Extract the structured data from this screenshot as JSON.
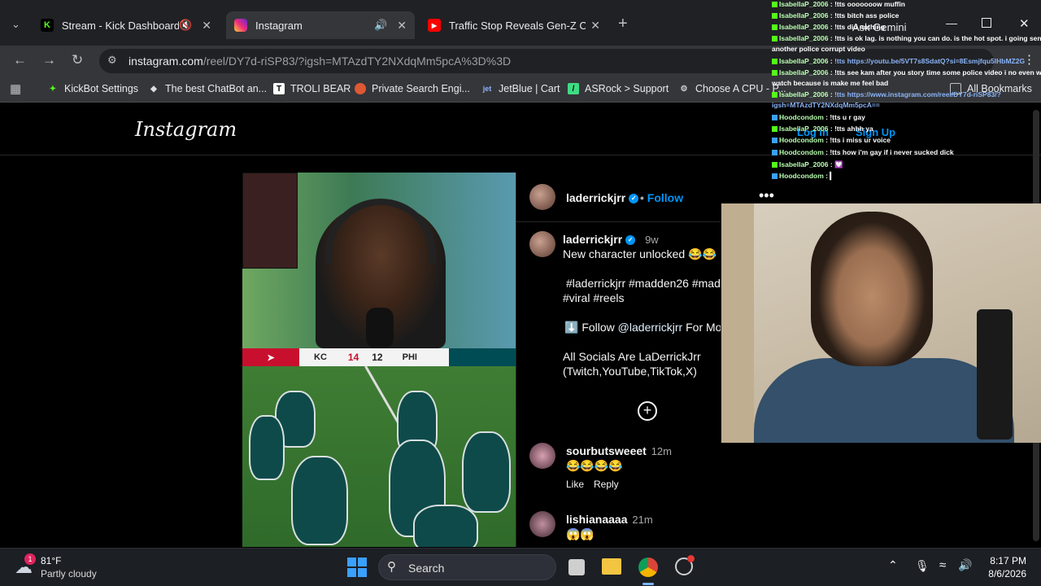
{
  "browser": {
    "tabs": [
      {
        "title": "Stream - Kick Dashboard",
        "favicon": "K",
        "color": "#53fc18"
      },
      {
        "title": "Instagram",
        "favicon": "ig",
        "color": "#e1306c"
      },
      {
        "title": "Traffic Stop Reveals Gen-Z Coup",
        "favicon": "yt",
        "color": "#ff0000"
      }
    ],
    "new_tab": "+",
    "url_host": "instagram.com",
    "url_path": "/reel/DY7d-riSP83/?igsh=MTAzdTY2NXdqMm5pcA%3D%3D",
    "ask_gemini": "Ask Gemini",
    "bookmarks": [
      {
        "label": "KickBot Settings",
        "icon_color": "#53fc18"
      },
      {
        "label": "The best ChatBot an...",
        "icon_color": "#cccccc"
      },
      {
        "label": "TROLI BEAR",
        "icon_color": "#ffffff"
      },
      {
        "label": "Private Search Engi...",
        "icon_color": "#de5833"
      },
      {
        "label": "JetBlue | Cart",
        "icon_color": "#1a3f8f"
      },
      {
        "label": "ASRock > Support",
        "icon_color": "#3ddc84"
      },
      {
        "label": "Choose A CPU - P...",
        "icon_color": "#aaaaaa"
      }
    ],
    "all_bookmarks": "All Bookmarks"
  },
  "instagram": {
    "logo": "Instagram",
    "login": "Log in",
    "signup": "Sign Up",
    "post": {
      "username": "laderrickjrr",
      "follow": "Follow",
      "caption_user": "laderrickjrr",
      "caption_time": "9w",
      "caption_line1": "New character unlocked 😂😂",
      "hashtags_line1": "#laderrickjrr #madden26 #mad",
      "hashtags_line2": "#viral #reels",
      "follow_line_prefix": "⬇️ Follow",
      "follow_line_handle": "@laderrickjrr",
      "follow_line_suffix": "For Mo",
      "socials_line1": "All Socials Are LaDerrickJrr",
      "socials_line2": "(Twitch,YouTube,TikTok,X)"
    },
    "scoreboard": {
      "team1": "KC",
      "score1": "14",
      "score2": "12",
      "team2": "PHI"
    },
    "comments": [
      {
        "user": "sourbutsweeet",
        "time": "12m",
        "text": "😂😂😂😂",
        "like": "Like",
        "reply": "Reply"
      },
      {
        "user": "lishianaaaa",
        "time": "21m",
        "text": "😱😱"
      }
    ]
  },
  "chat": [
    {
      "user": "IsabellaP_2006",
      "msg": "!tts ooooooow muffin"
    },
    {
      "user": "IsabellaP_2006",
      "msg": "!tts bitch ass police"
    },
    {
      "user": "IsabellaP_2006",
      "msg": "!tts did nothing"
    },
    {
      "user": "IsabellaP_2006",
      "msg": "!tts is ok lag. is nothing you can do. is the hot spot. i going send"
    },
    {
      "user": "",
      "msg": "another police corrupt video"
    },
    {
      "user": "IsabellaP_2006",
      "msg": "!tts https://youtu.be/5VT7s8SdatQ?si=8Esmjfqu5lHbMZ2G"
    },
    {
      "user": "IsabellaP_2006",
      "msg": "!tts see kam after you story time some police video i no even want to"
    },
    {
      "user": "",
      "msg": "watch because is make me feel bad"
    },
    {
      "user": "IsabellaP_2006",
      "msg": "!tts https://www.instagram.com/reel/DY7d-riSP83/?"
    },
    {
      "user": "",
      "msg": "igsh=MTAzdTY2NXdqMm5pcA=="
    },
    {
      "user": "Hoodcondom",
      "msg": "!tts u r gay"
    },
    {
      "user": "IsabellaP_2006",
      "msg": "!tts ahhh ya"
    },
    {
      "user": "Hoodcondom",
      "msg": "!tts i miss ur voice"
    },
    {
      "user": "Hoodcondom",
      "msg": "!tts how i'm gay if i never sucked dick"
    },
    {
      "user": "IsabellaP_2006",
      "msg": "💟"
    },
    {
      "user": "Hoodcondom",
      "msg": "▎"
    }
  ],
  "taskbar": {
    "weather_temp": "81°F",
    "weather_desc": "Partly cloudy",
    "weather_badge": "1",
    "search": "Search",
    "time": "8:17 PM",
    "date": "8/6/2026"
  }
}
